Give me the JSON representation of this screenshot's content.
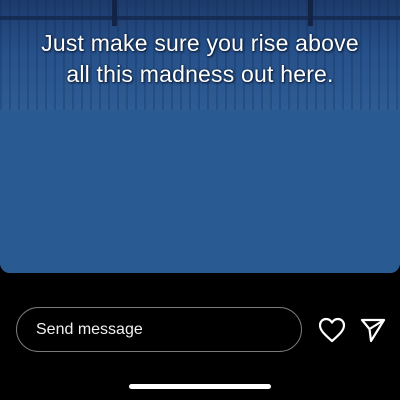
{
  "story": {
    "caption_lines": [
      "Just make sure you rise above",
      "all this madness out here."
    ]
  },
  "reply": {
    "placeholder": "Send message"
  },
  "icons": {
    "like": "heart-icon",
    "send": "paper-plane-icon"
  },
  "colors": {
    "background": "#000000",
    "media": "#27568a",
    "text": "#ffffff",
    "field_border": "#7b7b7b"
  }
}
